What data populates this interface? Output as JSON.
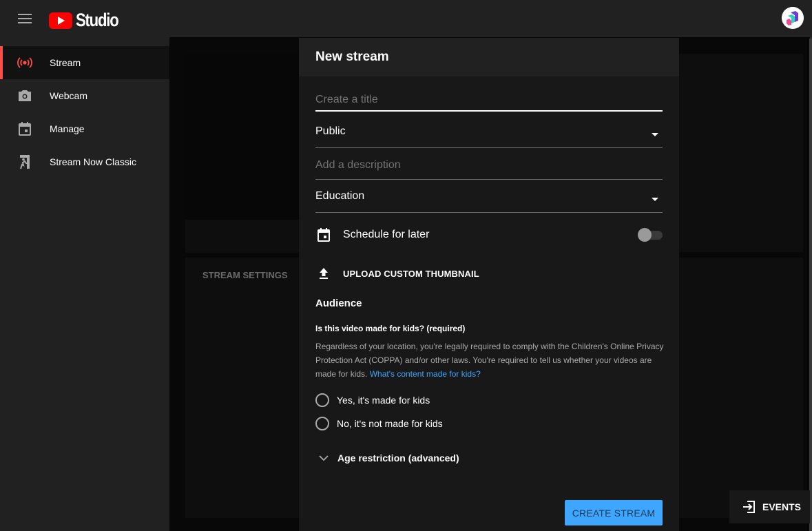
{
  "app": {
    "title": "Studio",
    "accent": "#ff0000"
  },
  "sidebar": {
    "items": [
      {
        "label": "Stream",
        "icon": "broadcast-icon",
        "active": true
      },
      {
        "label": "Webcam",
        "icon": "camera-icon",
        "active": false
      },
      {
        "label": "Manage",
        "icon": "calendar-icon",
        "active": false
      },
      {
        "label": "Stream Now Classic",
        "icon": "exit-run-icon",
        "active": false
      }
    ]
  },
  "background": {
    "stream_settings_label": "STREAM SETTINGS"
  },
  "dialog": {
    "title": "New stream",
    "title_field": {
      "placeholder": "Create a title",
      "value": ""
    },
    "visibility": {
      "selected": "Public"
    },
    "description_field": {
      "placeholder": "Add a description",
      "value": ""
    },
    "category": {
      "selected": "Education"
    },
    "schedule": {
      "label": "Schedule for later",
      "enabled": false
    },
    "upload_thumbnail_label": "UPLOAD CUSTOM THUMBNAIL",
    "audience": {
      "title": "Audience",
      "question": "Is this video made for kids? (required)",
      "explanation": "Regardless of your location, you're legally required to comply with the Children's Online Privacy Protection Act (COPPA) and/or other laws. You're required to tell us whether your videos are made for kids. ",
      "link_text": "What's content made for kids?",
      "options": [
        {
          "label": "Yes, it's made for kids",
          "selected": false
        },
        {
          "label": "No, it's not made for kids",
          "selected": false
        }
      ]
    },
    "age_restriction_label": "Age restriction (advanced)",
    "create_button_label": "CREATE STREAM",
    "create_button_color": "#3ea6ff"
  },
  "events_button_label": "EVENTS"
}
